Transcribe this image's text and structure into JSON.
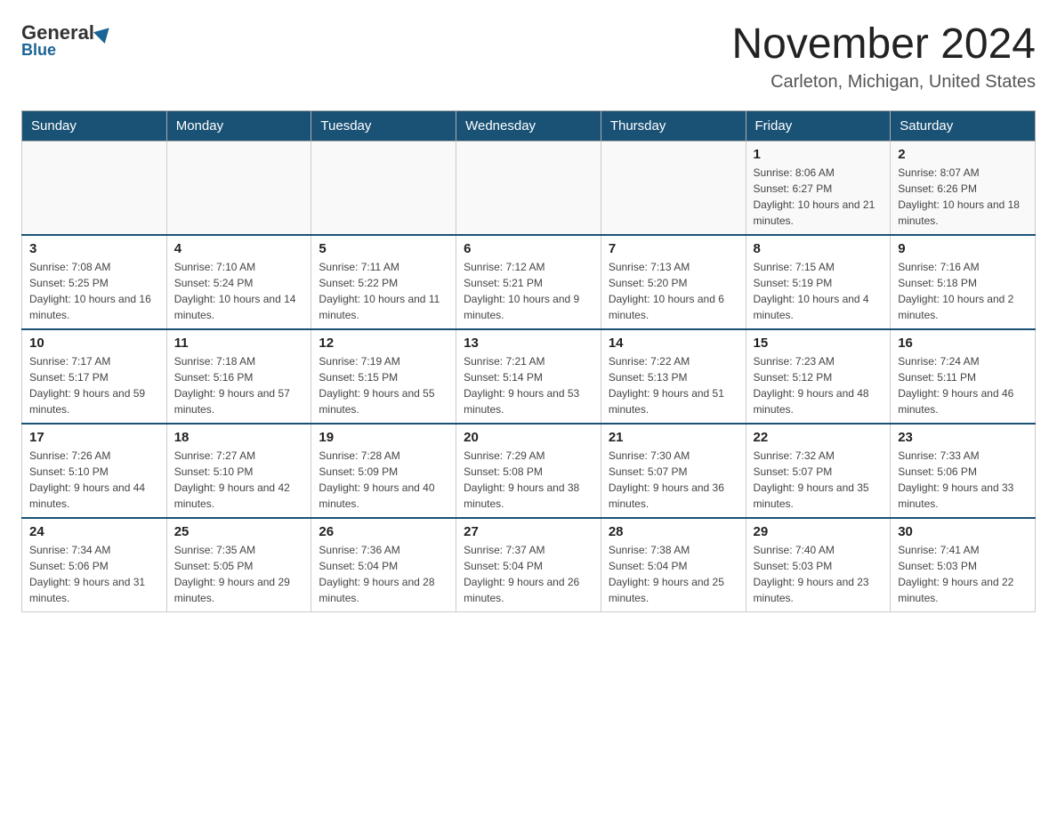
{
  "logo": {
    "general": "General",
    "blue": "Blue"
  },
  "title": "November 2024",
  "subtitle": "Carleton, Michigan, United States",
  "weekdays": [
    "Sunday",
    "Monday",
    "Tuesday",
    "Wednesday",
    "Thursday",
    "Friday",
    "Saturday"
  ],
  "weeks": [
    [
      {
        "day": "",
        "sunrise": "",
        "sunset": "",
        "daylight": ""
      },
      {
        "day": "",
        "sunrise": "",
        "sunset": "",
        "daylight": ""
      },
      {
        "day": "",
        "sunrise": "",
        "sunset": "",
        "daylight": ""
      },
      {
        "day": "",
        "sunrise": "",
        "sunset": "",
        "daylight": ""
      },
      {
        "day": "",
        "sunrise": "",
        "sunset": "",
        "daylight": ""
      },
      {
        "day": "1",
        "sunrise": "Sunrise: 8:06 AM",
        "sunset": "Sunset: 6:27 PM",
        "daylight": "Daylight: 10 hours and 21 minutes."
      },
      {
        "day": "2",
        "sunrise": "Sunrise: 8:07 AM",
        "sunset": "Sunset: 6:26 PM",
        "daylight": "Daylight: 10 hours and 18 minutes."
      }
    ],
    [
      {
        "day": "3",
        "sunrise": "Sunrise: 7:08 AM",
        "sunset": "Sunset: 5:25 PM",
        "daylight": "Daylight: 10 hours and 16 minutes."
      },
      {
        "day": "4",
        "sunrise": "Sunrise: 7:10 AM",
        "sunset": "Sunset: 5:24 PM",
        "daylight": "Daylight: 10 hours and 14 minutes."
      },
      {
        "day": "5",
        "sunrise": "Sunrise: 7:11 AM",
        "sunset": "Sunset: 5:22 PM",
        "daylight": "Daylight: 10 hours and 11 minutes."
      },
      {
        "day": "6",
        "sunrise": "Sunrise: 7:12 AM",
        "sunset": "Sunset: 5:21 PM",
        "daylight": "Daylight: 10 hours and 9 minutes."
      },
      {
        "day": "7",
        "sunrise": "Sunrise: 7:13 AM",
        "sunset": "Sunset: 5:20 PM",
        "daylight": "Daylight: 10 hours and 6 minutes."
      },
      {
        "day": "8",
        "sunrise": "Sunrise: 7:15 AM",
        "sunset": "Sunset: 5:19 PM",
        "daylight": "Daylight: 10 hours and 4 minutes."
      },
      {
        "day": "9",
        "sunrise": "Sunrise: 7:16 AM",
        "sunset": "Sunset: 5:18 PM",
        "daylight": "Daylight: 10 hours and 2 minutes."
      }
    ],
    [
      {
        "day": "10",
        "sunrise": "Sunrise: 7:17 AM",
        "sunset": "Sunset: 5:17 PM",
        "daylight": "Daylight: 9 hours and 59 minutes."
      },
      {
        "day": "11",
        "sunrise": "Sunrise: 7:18 AM",
        "sunset": "Sunset: 5:16 PM",
        "daylight": "Daylight: 9 hours and 57 minutes."
      },
      {
        "day": "12",
        "sunrise": "Sunrise: 7:19 AM",
        "sunset": "Sunset: 5:15 PM",
        "daylight": "Daylight: 9 hours and 55 minutes."
      },
      {
        "day": "13",
        "sunrise": "Sunrise: 7:21 AM",
        "sunset": "Sunset: 5:14 PM",
        "daylight": "Daylight: 9 hours and 53 minutes."
      },
      {
        "day": "14",
        "sunrise": "Sunrise: 7:22 AM",
        "sunset": "Sunset: 5:13 PM",
        "daylight": "Daylight: 9 hours and 51 minutes."
      },
      {
        "day": "15",
        "sunrise": "Sunrise: 7:23 AM",
        "sunset": "Sunset: 5:12 PM",
        "daylight": "Daylight: 9 hours and 48 minutes."
      },
      {
        "day": "16",
        "sunrise": "Sunrise: 7:24 AM",
        "sunset": "Sunset: 5:11 PM",
        "daylight": "Daylight: 9 hours and 46 minutes."
      }
    ],
    [
      {
        "day": "17",
        "sunrise": "Sunrise: 7:26 AM",
        "sunset": "Sunset: 5:10 PM",
        "daylight": "Daylight: 9 hours and 44 minutes."
      },
      {
        "day": "18",
        "sunrise": "Sunrise: 7:27 AM",
        "sunset": "Sunset: 5:10 PM",
        "daylight": "Daylight: 9 hours and 42 minutes."
      },
      {
        "day": "19",
        "sunrise": "Sunrise: 7:28 AM",
        "sunset": "Sunset: 5:09 PM",
        "daylight": "Daylight: 9 hours and 40 minutes."
      },
      {
        "day": "20",
        "sunrise": "Sunrise: 7:29 AM",
        "sunset": "Sunset: 5:08 PM",
        "daylight": "Daylight: 9 hours and 38 minutes."
      },
      {
        "day": "21",
        "sunrise": "Sunrise: 7:30 AM",
        "sunset": "Sunset: 5:07 PM",
        "daylight": "Daylight: 9 hours and 36 minutes."
      },
      {
        "day": "22",
        "sunrise": "Sunrise: 7:32 AM",
        "sunset": "Sunset: 5:07 PM",
        "daylight": "Daylight: 9 hours and 35 minutes."
      },
      {
        "day": "23",
        "sunrise": "Sunrise: 7:33 AM",
        "sunset": "Sunset: 5:06 PM",
        "daylight": "Daylight: 9 hours and 33 minutes."
      }
    ],
    [
      {
        "day": "24",
        "sunrise": "Sunrise: 7:34 AM",
        "sunset": "Sunset: 5:06 PM",
        "daylight": "Daylight: 9 hours and 31 minutes."
      },
      {
        "day": "25",
        "sunrise": "Sunrise: 7:35 AM",
        "sunset": "Sunset: 5:05 PM",
        "daylight": "Daylight: 9 hours and 29 minutes."
      },
      {
        "day": "26",
        "sunrise": "Sunrise: 7:36 AM",
        "sunset": "Sunset: 5:04 PM",
        "daylight": "Daylight: 9 hours and 28 minutes."
      },
      {
        "day": "27",
        "sunrise": "Sunrise: 7:37 AM",
        "sunset": "Sunset: 5:04 PM",
        "daylight": "Daylight: 9 hours and 26 minutes."
      },
      {
        "day": "28",
        "sunrise": "Sunrise: 7:38 AM",
        "sunset": "Sunset: 5:04 PM",
        "daylight": "Daylight: 9 hours and 25 minutes."
      },
      {
        "day": "29",
        "sunrise": "Sunrise: 7:40 AM",
        "sunset": "Sunset: 5:03 PM",
        "daylight": "Daylight: 9 hours and 23 minutes."
      },
      {
        "day": "30",
        "sunrise": "Sunrise: 7:41 AM",
        "sunset": "Sunset: 5:03 PM",
        "daylight": "Daylight: 9 hours and 22 minutes."
      }
    ]
  ]
}
